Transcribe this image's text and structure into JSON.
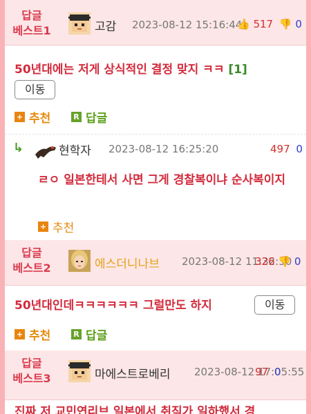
{
  "posts": [
    {
      "badge": "답글\n베스트1",
      "nickname": "고감",
      "date": "2023-08-12 15:16:44",
      "up": "517",
      "down": "0",
      "content": "50년대에는 저게 상식적인 결정 맞지 ㅋㅋ",
      "reply_count": "[1]",
      "move_label": "이동",
      "recommend_label": "추천",
      "reply_label": "답글"
    },
    {
      "badge": "답글\n베스트2",
      "nickname": "에스더니나브",
      "date": "2023-08-12 11:32:30",
      "up": "326",
      "down": "0",
      "content": "50년대인데ㅋㅋㅋㅋㅋㅋ 그럴만도 하지",
      "move_label": "이동",
      "recommend_label": "추천",
      "reply_label": "답글"
    },
    {
      "badge": "답글\n베스트3",
      "nickname": "마에스트로베리",
      "date": "2023-08-12 17:05:55",
      "up": "97",
      "down": "0",
      "content": "진짜 저 교민연리브 일본에서 취직가 일하했서 경"
    }
  ],
  "reply": {
    "nickname": "현학자",
    "date": "2023-08-12 16:25:20",
    "up": "497",
    "down": "0",
    "content": "ㄹㅇ 일본한테서 사면 그게 경찰복이냐 순사복이지",
    "recommend_label": "추천"
  },
  "colors": {
    "background": "#f9b3b6",
    "accent": "#d83a4d",
    "header_bg": "#fde6e7"
  }
}
